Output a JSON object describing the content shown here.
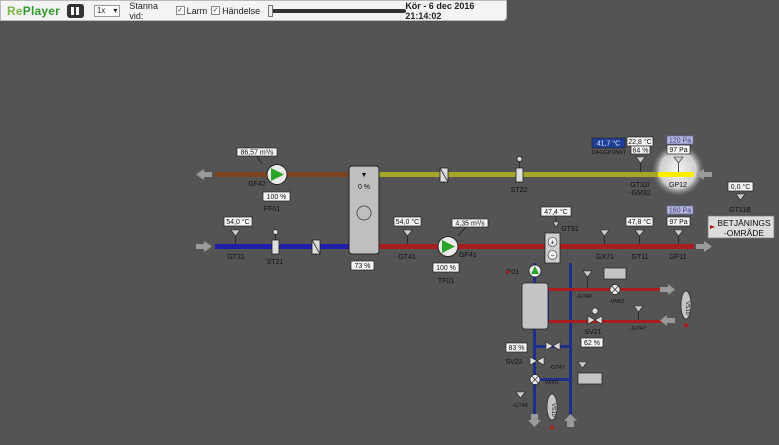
{
  "toolbar": {
    "logo_re": "Re",
    "logo_player": "Player",
    "speed": "1x",
    "stop_label": "Stanna vid:",
    "alarm_label": "Larm",
    "event_label": "Händelse",
    "check_mark": "✓",
    "status": "Kör - 6 dec 2016 21:14:02"
  },
  "values": {
    "flow_top": "86,57 m³/s",
    "gf42_pct": "100 %",
    "exch_pct": "0 %",
    "exch_bottom_pct": "73 %",
    "gt31_val": "54,0 °C",
    "gt41_val": "54,0 °C",
    "gf41_flow": "4,35 m³/s",
    "gf41_pct": "100 %",
    "dagg_val": "41,7 °C",
    "gt32_val": "22,8 °C",
    "gt32_pct": "64 %",
    "gp12_top": "120 Pa",
    "gp12_val": "97 Pa",
    "gt81_val": "47,4 °C",
    "gt11_val": "47,8 °C",
    "gp11_top": "160 Pa",
    "gp11_val": "97 Pa",
    "gt11b_val": "0,0 °C",
    "sv22_pct": "83 %",
    "sv21_pct": "62 %",
    "sv_unit": "%"
  },
  "labels": {
    "gf42": "GF42",
    "ff01": "FF01",
    "st22": "ST22",
    "dagg": "DAGGPUNKT",
    "gt32": "GT32/",
    "gm32": "-GM32",
    "gp12": "GP12",
    "gt11b": "GT11B",
    "betj1": "BETJÄNINGS",
    "betj2": "-OMRÅDE",
    "gt31": "GT31",
    "st21": "ST21",
    "gt41": "GT41",
    "gf41": "GF41",
    "tf01": "TF01",
    "gt81": "GT81",
    "gx71": "GX71",
    "gt11": "GT11",
    "gp11": "GP11",
    "p01": "P01",
    "gt40": "-GT40",
    "vm01a": "-VM01",
    "sv21": "SV21",
    "gt47a": "-GT47",
    "sv22": "SV22",
    "gt47b": "-GT47",
    "vm01b": "-VM01",
    "gt48": "-GT48",
    "vs10a": "VS10",
    "vs10b": "VS10"
  },
  "colors": {
    "brown_pipe": "#7a4420",
    "yellow_pipe": "#a6a62a",
    "blue_pipe": "#1e1ea8",
    "red_pipe": "#a81e1e",
    "navy_pipe": "#1e2e8a",
    "pump_green": "#2aa52a",
    "highlight_yellow": "#ffee00"
  }
}
